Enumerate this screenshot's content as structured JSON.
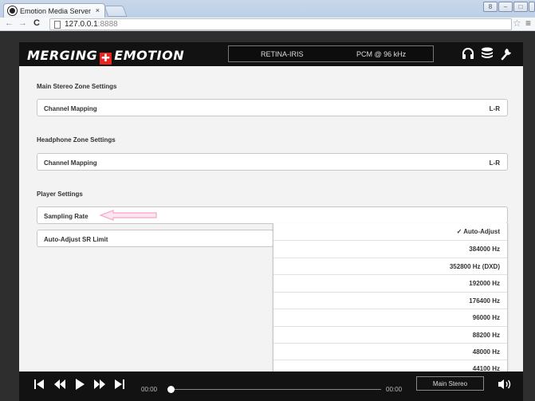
{
  "browser": {
    "tab_title": "Emotion Media Server",
    "tab_close": "×",
    "url_host": "127.0.0.1",
    "url_port": ":8888",
    "back": "←",
    "forward": "→",
    "reload": "C",
    "star": "☆",
    "menu": "≡",
    "user": "8",
    "minimize": "‒",
    "maximize": "□",
    "close": "✕"
  },
  "header": {
    "logo_left": "MERGING",
    "logo_cross": "✚",
    "logo_right": "EMOTION",
    "device": "RETINA-IRIS",
    "format": "PCM @ 96 kHz",
    "icons": [
      "headphones-icon",
      "database-icon",
      "wrench-icon"
    ]
  },
  "sections": {
    "main_stereo": {
      "title": "Main Stereo Zone Settings",
      "channel_mapping_label": "Channel Mapping",
      "channel_mapping_value": "L-R"
    },
    "headphone": {
      "title": "Headphone Zone Settings",
      "channel_mapping_label": "Channel Mapping",
      "channel_mapping_value": "L-R"
    },
    "player": {
      "title": "Player Settings",
      "sampling_rate_label": "Sampling Rate",
      "auto_adjust_label": "Auto-Adjust SR Limit"
    }
  },
  "dropdown": {
    "items": [
      "✓ Auto-Adjust",
      "384000 Hz",
      "352800 Hz (DXD)",
      "192000 Hz",
      "176400 Hz",
      "96000 Hz",
      "88200 Hz",
      "48000 Hz",
      "44100 Hz"
    ]
  },
  "transport": {
    "first": "⏮",
    "rewind": "⏪",
    "play": "▶",
    "forward": "⏩",
    "last": "⏭",
    "time_elapsed": "00:00",
    "time_total": "00:00",
    "zone": "Main Stereo",
    "volume": "🔊",
    "progress": 0
  },
  "colors": {
    "brand_red": "#e8261f",
    "header_bg": "#121212",
    "content_bg": "#f3f3f3",
    "annotation_pink": "#f2a6c8"
  }
}
